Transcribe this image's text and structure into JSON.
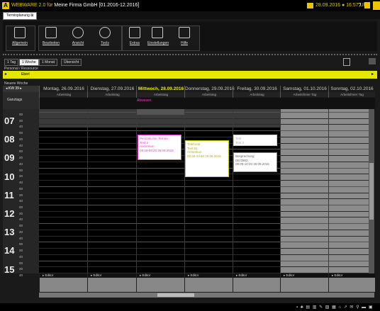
{
  "app": {
    "logo": "A",
    "title_prefix": "WEBWARE 2.0 für ",
    "title_company": "Meine Firma GmbH",
    "title_period": " [01.2016-12.2016]",
    "datetime": "28.09.2016 ● 16:57 Uhr",
    "help": "?"
  },
  "tabs": {
    "active": "Terminplanung ⊠"
  },
  "toolbar": {
    "groups": [
      {
        "items": [
          {
            "label": "Allgemein",
            "icon": "diagonal-arrow-icon"
          }
        ]
      },
      {
        "items": [
          {
            "label": "Bearbeiten",
            "icon": "edit-document-icon"
          },
          {
            "label": "Ansicht",
            "icon": "magnifier-icon"
          },
          {
            "label": "Tools",
            "icon": "gears-icon"
          }
        ]
      },
      {
        "items": [
          {
            "label": "Extras",
            "icon": "extras-icon"
          },
          {
            "label": "Einstellungen",
            "icon": "settings-icon"
          },
          {
            "label": "Hilfe",
            "icon": "help-document-icon"
          }
        ]
      }
    ]
  },
  "views": {
    "tabs": [
      "1 Tag",
      "1 Woche",
      "1 Monat",
      "Übersicht"
    ],
    "active_index": 1
  },
  "personal": {
    "label": "Personal / Ressource",
    "value": "Eberl",
    "arrow_left": "◂",
    "arrow_right": "▸"
  },
  "section_new": "Neuere Woche",
  "week": {
    "kw": "◂  KW 39  ▸",
    "allday_label": "Ganztags",
    "days": [
      {
        "name": "Montag, 26.09.2016",
        "type": "Arbeitstag"
      },
      {
        "name": "Dienstag, 27.09.2016",
        "type": "Arbeitstag"
      },
      {
        "name": "Mittwoch, 28.09.2016",
        "type": "Arbeitstag"
      },
      {
        "name": "Donnerstag, 29.09.2016",
        "type": "Arbeitstag"
      },
      {
        "name": "Freitag, 30.09.2016",
        "type": "Arbeitstag"
      },
      {
        "name": "Samstag, 01.10.2016",
        "type": "Arbeitsfreier Tag"
      },
      {
        "name": "Sonntag, 02.10.2016",
        "type": "Arbeitsfreier Tag"
      }
    ],
    "today_index": 2,
    "allday_events": [
      "Abwesen."
    ]
  },
  "hours": [
    "07",
    "08",
    "09",
    "10",
    "11",
    "12",
    "13",
    "14",
    "15"
  ],
  "minutes": [
    "00",
    "20",
    "40"
  ],
  "appointments": [
    {
      "lines": [
        "Persönlicher Termin",
        "Test 2",
        "Anmerkun",
        "08:20-09:20 28.09.2016"
      ]
    },
    {
      "lines": [
        "Telefonat",
        "Test 81",
        "Anmerkun",
        "08:40-10:40 29.09.2016"
      ]
    },
    {
      "lines": [
        "Test",
        "Test 3",
        "Test"
      ]
    },
    {
      "lines": [
        "Besprechung",
        "DE/2863",
        "09:00-10:20 30.09.2016"
      ]
    }
  ],
  "editor": {
    "label": "▸ Editor"
  },
  "status_icons": "▪ ♣ ▤ ▥ ✎ ▧ ▦ ⌂ ↗ ✉ ⚲ ▬ ▣"
}
